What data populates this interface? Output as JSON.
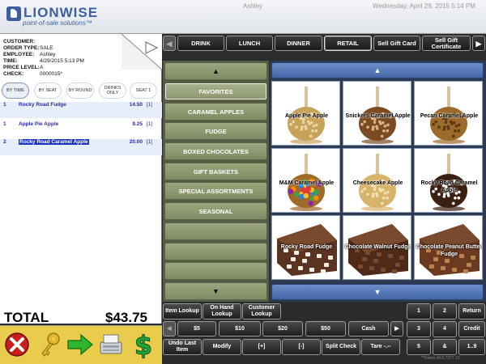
{
  "app": {
    "logo_name": "LIONWISE",
    "logo_tagline": "point-of-sale solutions™",
    "user": "Ashley",
    "datetime": "Wednesday, April 29, 2015 5:14 PM",
    "brand_color": "#3d5f9e"
  },
  "order": {
    "fields": [
      {
        "label": "CUSTOMER:",
        "value": ""
      },
      {
        "label": "ORDER TYPE:",
        "value": "SALE"
      },
      {
        "label": "EMPLOYEE:",
        "value": "Ashley"
      },
      {
        "label": "TIME:",
        "value": "4/29/2015 5:13 PM"
      },
      {
        "label": "PRICE LEVEL:",
        "value": "A"
      },
      {
        "label": "CHECK:",
        "value": "0000015*"
      }
    ],
    "sort_tabs": [
      "BY TIME",
      "BY SEAT",
      "BY ROUND",
      "DRINKS ONLY",
      "SEAT 1"
    ],
    "items": [
      {
        "seat": "1",
        "name": "Rocky Road Fudge",
        "price": "14.50",
        "qty": "[1]"
      },
      {
        "seat": "1",
        "name": "Apple Pie Apple",
        "price": "9.25",
        "qty": "[1]"
      },
      {
        "seat": "2",
        "name": "Rocky Road Caramel Apple",
        "price": "20.00",
        "qty": "[1]"
      }
    ],
    "total_label": "TOTAL",
    "total_value": "$43.75"
  },
  "icon_bar": [
    "cancel-icon",
    "key-icon",
    "arrow-right-icon",
    "register-icon",
    "dollar-icon"
  ],
  "top_tabs": [
    "DRINK",
    "LUNCH",
    "DINNER",
    "RETAIL",
    "Sell Gift Card",
    "Sell Gift Certificate"
  ],
  "categories": [
    "FAVORITES",
    "CARAMEL APPLES",
    "FUDGE",
    "BOXED CHOCOLATES",
    "GIFT BASKETS",
    "SPECIAL ASSORTMENTS",
    "SEASONAL",
    "",
    "",
    ""
  ],
  "arrows": {
    "up": "▲",
    "down": "▼",
    "left": "◀",
    "right": "▶"
  },
  "products": [
    {
      "name": "Apple Pie Apple",
      "kind": "apple",
      "coat": "#c9a25a",
      "dots": "#e8d7a6"
    },
    {
      "name": "Snickers Caramel Apple",
      "kind": "apple",
      "coat": "#7a4a22",
      "dots": "#d9b48a"
    },
    {
      "name": "Pecan Caramel Apple",
      "kind": "apple",
      "coat": "#9c6a2a",
      "dots": "#5a3a14"
    },
    {
      "name": "M&M Caramel Apple",
      "kind": "apple",
      "coat": "#a06a2b",
      "dots": "mm"
    },
    {
      "name": "Cheesecake Apple",
      "kind": "apple",
      "coat": "#d8b46a",
      "dots": "#f1e2b3"
    },
    {
      "name": "Rocky Road Caramel Apple",
      "kind": "apple",
      "coat": "#3b1f10",
      "dots": "#ffffff"
    },
    {
      "name": "Rocky Road Fudge",
      "kind": "fudge",
      "coat": "#5a3420",
      "dots": "#f4eee6"
    },
    {
      "name": "Chocolate Walnut Fudge",
      "kind": "fudge",
      "coat": "#4f2a18",
      "dots": "#7a4a2a"
    },
    {
      "name": "Chocolate Peanut Butter Fudge",
      "kind": "fudge",
      "coat": "#6b3a20",
      "dots": "#b98450"
    }
  ],
  "lookup_buttons": [
    "Item Lookup",
    "On Hand Lookup",
    "Customer Lookup"
  ],
  "cash_buttons": [
    "$5",
    "$10",
    "$20",
    "$50",
    "Cash"
  ],
  "action_buttons": [
    "Undo Last Item",
    "Modify",
    "[+]",
    "[-]",
    "Split Check",
    "Tare -.--"
  ],
  "keypad": [
    "1",
    "2",
    "Return",
    "3",
    "4",
    "Credit",
    "5",
    "&",
    "1..9"
  ],
  "version": "**Demo v8.5.7277.13"
}
